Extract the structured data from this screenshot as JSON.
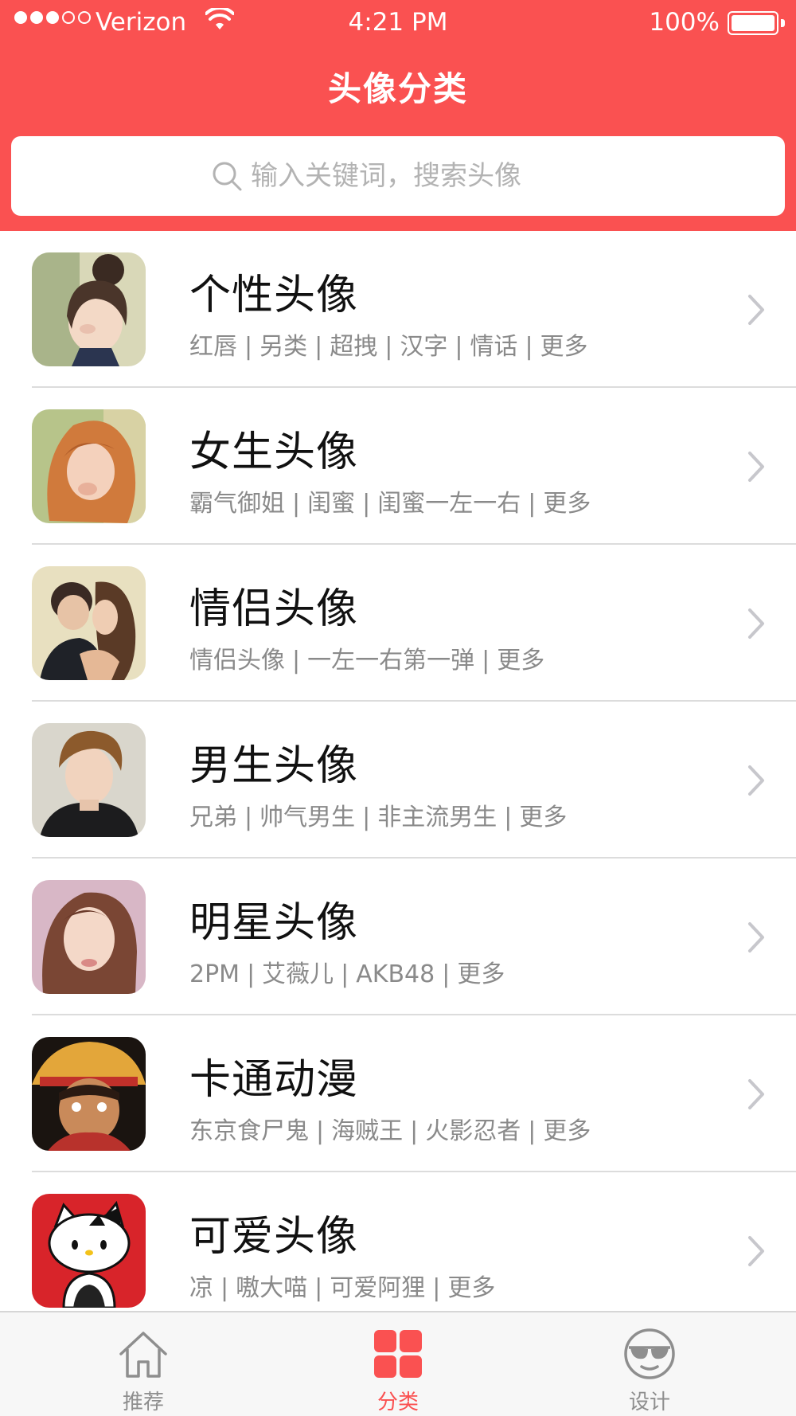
{
  "status_bar": {
    "carrier": "Verizon",
    "time": "4:21 PM",
    "battery": "100%",
    "signal_bars_filled": 3,
    "signal_bars_total": 5
  },
  "nav": {
    "title": "头像分类"
  },
  "search": {
    "placeholder": "输入关键词，搜索头像"
  },
  "categories": [
    {
      "title": "个性头像",
      "tags": [
        "红唇",
        "另类",
        "超拽",
        "汉字",
        "情话",
        "更多"
      ],
      "thumb": "avatar-girl-bun"
    },
    {
      "title": "女生头像",
      "tags": [
        "霸气御姐",
        "闺蜜",
        "闺蜜一左一右",
        "更多"
      ],
      "thumb": "avatar-girl-curly"
    },
    {
      "title": "情侣头像",
      "tags": [
        "情侣头像",
        "一左一右第一弹",
        "更多"
      ],
      "thumb": "avatar-couple"
    },
    {
      "title": "男生头像",
      "tags": [
        "兄弟",
        "帅气男生",
        "非主流男生",
        "更多"
      ],
      "thumb": "avatar-boy"
    },
    {
      "title": "明星头像",
      "tags": [
        "2PM",
        "艾薇儿",
        "AKB48",
        "更多"
      ],
      "thumb": "avatar-star"
    },
    {
      "title": "卡通动漫",
      "tags": [
        "东京食尸鬼",
        "海贼王",
        "火影忍者",
        "更多"
      ],
      "thumb": "avatar-cartoon"
    },
    {
      "title": "可爱头像",
      "tags": [
        "凉",
        "嗷大喵",
        "可爱阿狸",
        "更多"
      ],
      "thumb": "avatar-kitty"
    }
  ],
  "tabs": [
    {
      "label": "推荐",
      "icon": "home-icon",
      "active": false
    },
    {
      "label": "分类",
      "icon": "grid-icon",
      "active": true
    },
    {
      "label": "设计",
      "icon": "sunglasses-face-icon",
      "active": false
    }
  ],
  "colors": {
    "brand": "#fa5151",
    "title_text": "#111111",
    "tag_text": "#8a8a8a",
    "tab_inactive": "#8e8e8e"
  }
}
